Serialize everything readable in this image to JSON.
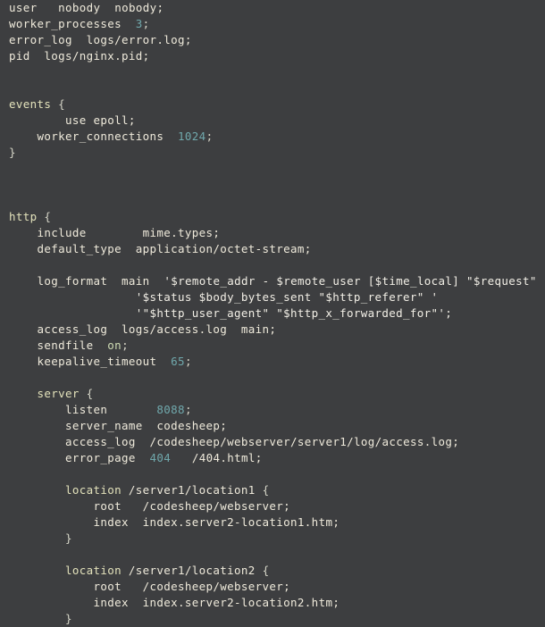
{
  "editor": {
    "background_color": "#3d3e40",
    "default_text_color": "#efeadb",
    "number_color": "#70a8ac",
    "block_keyword_color": "#e3e2bb",
    "string_color": "#f2efe6",
    "boolean_color": "#cfdcb4",
    "file_type": "nginx-config"
  },
  "lines": [
    {
      "indent": 0,
      "tokens": [
        {
          "t": "user",
          "c": "key"
        },
        {
          "t": "   ",
          "c": "plain"
        },
        {
          "t": "nobody",
          "c": "val"
        },
        {
          "t": "  ",
          "c": "plain"
        },
        {
          "t": "nobody;",
          "c": "val"
        }
      ]
    },
    {
      "indent": 0,
      "tokens": [
        {
          "t": "worker_processes",
          "c": "key"
        },
        {
          "t": "  ",
          "c": "plain"
        },
        {
          "t": "3",
          "c": "num"
        },
        {
          "t": ";",
          "c": "punct"
        }
      ]
    },
    {
      "indent": 0,
      "tokens": [
        {
          "t": "error_log",
          "c": "key"
        },
        {
          "t": "  ",
          "c": "plain"
        },
        {
          "t": "logs/error.log;",
          "c": "val"
        }
      ]
    },
    {
      "indent": 0,
      "tokens": [
        {
          "t": "pid",
          "c": "key"
        },
        {
          "t": "  ",
          "c": "plain"
        },
        {
          "t": "logs/nginx.pid;",
          "c": "val"
        }
      ]
    },
    {
      "indent": 0,
      "tokens": []
    },
    {
      "indent": 0,
      "tokens": []
    },
    {
      "indent": 0,
      "tokens": [
        {
          "t": "events",
          "c": "block"
        },
        {
          "t": " ",
          "c": "plain"
        },
        {
          "t": "{",
          "c": "brace"
        }
      ]
    },
    {
      "indent": 0,
      "tokens": [
        {
          "t": "        use epoll;",
          "c": "val"
        }
      ]
    },
    {
      "indent": 0,
      "tokens": [
        {
          "t": "    ",
          "c": "plain"
        },
        {
          "t": "worker_connections",
          "c": "key"
        },
        {
          "t": "  ",
          "c": "plain"
        },
        {
          "t": "1024",
          "c": "num"
        },
        {
          "t": ";",
          "c": "punct"
        }
      ]
    },
    {
      "indent": 0,
      "tokens": [
        {
          "t": "}",
          "c": "brace"
        }
      ]
    },
    {
      "indent": 0,
      "tokens": []
    },
    {
      "indent": 0,
      "tokens": []
    },
    {
      "indent": 0,
      "tokens": []
    },
    {
      "indent": 0,
      "tokens": [
        {
          "t": "http",
          "c": "block"
        },
        {
          "t": " ",
          "c": "plain"
        },
        {
          "t": "{",
          "c": "brace"
        }
      ]
    },
    {
      "indent": 0,
      "tokens": [
        {
          "t": "    ",
          "c": "plain"
        },
        {
          "t": "include",
          "c": "key"
        },
        {
          "t": "        ",
          "c": "plain"
        },
        {
          "t": "mime.types;",
          "c": "val"
        }
      ]
    },
    {
      "indent": 0,
      "tokens": [
        {
          "t": "    ",
          "c": "plain"
        },
        {
          "t": "default_type",
          "c": "key"
        },
        {
          "t": "  ",
          "c": "plain"
        },
        {
          "t": "application/octet-stream;",
          "c": "val"
        }
      ]
    },
    {
      "indent": 0,
      "tokens": []
    },
    {
      "indent": 0,
      "tokens": [
        {
          "t": "    ",
          "c": "plain"
        },
        {
          "t": "log_format",
          "c": "key"
        },
        {
          "t": "  ",
          "c": "plain"
        },
        {
          "t": "main",
          "c": "val"
        },
        {
          "t": "  ",
          "c": "plain"
        },
        {
          "t": "'$remote_addr - $remote_user [$time_local] \"$request\" '",
          "c": "str"
        }
      ]
    },
    {
      "indent": 0,
      "tokens": [
        {
          "t": "                  ",
          "c": "plain"
        },
        {
          "t": "'$status $body_bytes_sent \"$http_referer\" '",
          "c": "str"
        }
      ]
    },
    {
      "indent": 0,
      "tokens": [
        {
          "t": "                  ",
          "c": "plain"
        },
        {
          "t": "'\"$http_user_agent\" \"$http_x_forwarded_for\"';",
          "c": "str"
        }
      ]
    },
    {
      "indent": 0,
      "tokens": [
        {
          "t": "    ",
          "c": "plain"
        },
        {
          "t": "access_log",
          "c": "key"
        },
        {
          "t": "  ",
          "c": "plain"
        },
        {
          "t": "logs/access.log  main;",
          "c": "val"
        }
      ]
    },
    {
      "indent": 0,
      "tokens": [
        {
          "t": "    ",
          "c": "plain"
        },
        {
          "t": "sendfile",
          "c": "key"
        },
        {
          "t": "  ",
          "c": "plain"
        },
        {
          "t": "on",
          "c": "on"
        },
        {
          "t": ";",
          "c": "punct"
        }
      ]
    },
    {
      "indent": 0,
      "tokens": [
        {
          "t": "    ",
          "c": "plain"
        },
        {
          "t": "keepalive_timeout",
          "c": "key"
        },
        {
          "t": "  ",
          "c": "plain"
        },
        {
          "t": "65",
          "c": "num"
        },
        {
          "t": ";",
          "c": "punct"
        }
      ]
    },
    {
      "indent": 0,
      "tokens": []
    },
    {
      "indent": 0,
      "tokens": [
        {
          "t": "    ",
          "c": "plain"
        },
        {
          "t": "server",
          "c": "block"
        },
        {
          "t": " ",
          "c": "plain"
        },
        {
          "t": "{",
          "c": "brace"
        }
      ]
    },
    {
      "indent": 0,
      "tokens": [
        {
          "t": "        ",
          "c": "plain"
        },
        {
          "t": "listen",
          "c": "key"
        },
        {
          "t": "       ",
          "c": "plain"
        },
        {
          "t": "8088",
          "c": "num"
        },
        {
          "t": ";",
          "c": "punct"
        }
      ]
    },
    {
      "indent": 0,
      "tokens": [
        {
          "t": "        ",
          "c": "plain"
        },
        {
          "t": "server_name",
          "c": "key"
        },
        {
          "t": "  ",
          "c": "plain"
        },
        {
          "t": "codesheep;",
          "c": "val"
        }
      ]
    },
    {
      "indent": 0,
      "tokens": [
        {
          "t": "        ",
          "c": "plain"
        },
        {
          "t": "access_log",
          "c": "key"
        },
        {
          "t": "  ",
          "c": "plain"
        },
        {
          "t": "/codesheep/webserver/server1/log/access.log;",
          "c": "val"
        }
      ]
    },
    {
      "indent": 0,
      "tokens": [
        {
          "t": "        ",
          "c": "plain"
        },
        {
          "t": "error_page",
          "c": "key"
        },
        {
          "t": "  ",
          "c": "plain"
        },
        {
          "t": "404",
          "c": "num"
        },
        {
          "t": "   ",
          "c": "plain"
        },
        {
          "t": "/404.html;",
          "c": "val"
        }
      ]
    },
    {
      "indent": 0,
      "tokens": []
    },
    {
      "indent": 0,
      "tokens": [
        {
          "t": "        ",
          "c": "plain"
        },
        {
          "t": "location",
          "c": "block"
        },
        {
          "t": " ",
          "c": "plain"
        },
        {
          "t": "/server1/location1",
          "c": "val"
        },
        {
          "t": " ",
          "c": "plain"
        },
        {
          "t": "{",
          "c": "brace"
        }
      ]
    },
    {
      "indent": 0,
      "tokens": [
        {
          "t": "            ",
          "c": "plain"
        },
        {
          "t": "root",
          "c": "key"
        },
        {
          "t": "   ",
          "c": "plain"
        },
        {
          "t": "/codesheep/webserver;",
          "c": "val"
        }
      ]
    },
    {
      "indent": 0,
      "tokens": [
        {
          "t": "            ",
          "c": "plain"
        },
        {
          "t": "index",
          "c": "key"
        },
        {
          "t": "  ",
          "c": "plain"
        },
        {
          "t": "index.server2-location1.htm;",
          "c": "val"
        }
      ]
    },
    {
      "indent": 0,
      "tokens": [
        {
          "t": "        ",
          "c": "plain"
        },
        {
          "t": "}",
          "c": "brace"
        }
      ]
    },
    {
      "indent": 0,
      "tokens": []
    },
    {
      "indent": 0,
      "tokens": [
        {
          "t": "        ",
          "c": "plain"
        },
        {
          "t": "location",
          "c": "block"
        },
        {
          "t": " ",
          "c": "plain"
        },
        {
          "t": "/server1/location2",
          "c": "val"
        },
        {
          "t": " ",
          "c": "plain"
        },
        {
          "t": "{",
          "c": "brace"
        }
      ]
    },
    {
      "indent": 0,
      "tokens": [
        {
          "t": "            ",
          "c": "plain"
        },
        {
          "t": "root",
          "c": "key"
        },
        {
          "t": "   ",
          "c": "plain"
        },
        {
          "t": "/codesheep/webserver;",
          "c": "val"
        }
      ]
    },
    {
      "indent": 0,
      "tokens": [
        {
          "t": "            ",
          "c": "plain"
        },
        {
          "t": "index",
          "c": "key"
        },
        {
          "t": "  ",
          "c": "plain"
        },
        {
          "t": "index.server2-location2.htm;",
          "c": "val"
        }
      ]
    },
    {
      "indent": 0,
      "tokens": [
        {
          "t": "        ",
          "c": "plain"
        },
        {
          "t": "}",
          "c": "brace"
        }
      ]
    }
  ]
}
